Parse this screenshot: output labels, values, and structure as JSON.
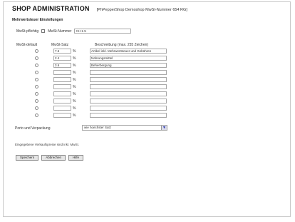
{
  "header": {
    "app_title": "SHOP ADMINISTRATION",
    "shop_info": "[PhPepperShop Demoshop MwSt-Nummer 654 RG]"
  },
  "section_title": "Mehrwertsteuer Einstellungen",
  "ust": {
    "checkbox_label": "MwSt-pflichtig",
    "number_label": "MwSt-Nummer",
    "number_value": "CH 1-5"
  },
  "columns": {
    "default": "MwSt-default",
    "rate": "MwSt-Satz",
    "description": "Beschreibung (max. 255 Zeichen)"
  },
  "rows": [
    {
      "rate": "7.6",
      "description": "Artikel inkl. Mehrwertsteuer und Gebühren"
    },
    {
      "rate": "2.4",
      "description": "Nahrungsmittel"
    },
    {
      "rate": "3.6",
      "description": "Beherbergung"
    },
    {
      "rate": "",
      "description": ""
    },
    {
      "rate": "",
      "description": ""
    },
    {
      "rate": "",
      "description": ""
    },
    {
      "rate": "",
      "description": ""
    },
    {
      "rate": "",
      "description": ""
    },
    {
      "rate": "",
      "description": ""
    },
    {
      "rate": "",
      "description": ""
    }
  ],
  "percent_symbol": "%",
  "porto": {
    "label": "Porto und Verpackung",
    "selected": "wie hoechster Satz"
  },
  "note": "Eingegebene Verkaufspreise sind inkl. MwSt.",
  "buttons": {
    "save": "Speichern",
    "cancel": "Abbrechen",
    "help": "Hilfe"
  },
  "icons": {
    "select_arrow": "▼"
  }
}
